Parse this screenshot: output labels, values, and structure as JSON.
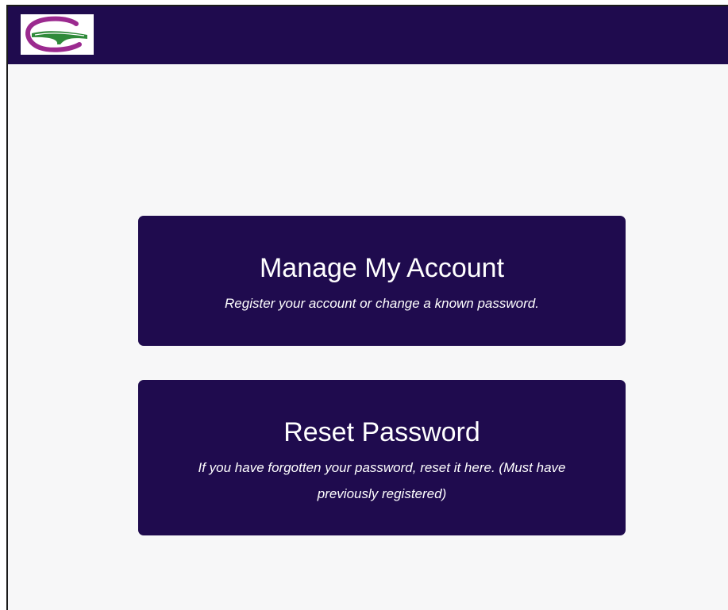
{
  "header": {
    "logo_icon": "company-g-logo-icon",
    "brand_color": "#1f0b4e",
    "logo_colors": {
      "arc": "#9b2a8f",
      "stripe": "#2f8a3a"
    }
  },
  "cards": {
    "manage": {
      "title": "Manage My Account",
      "description": "Register your account or change a known password."
    },
    "reset": {
      "title": "Reset Password",
      "description": "If you have forgotten your password, reset it here. (Must have previously registered)"
    }
  }
}
